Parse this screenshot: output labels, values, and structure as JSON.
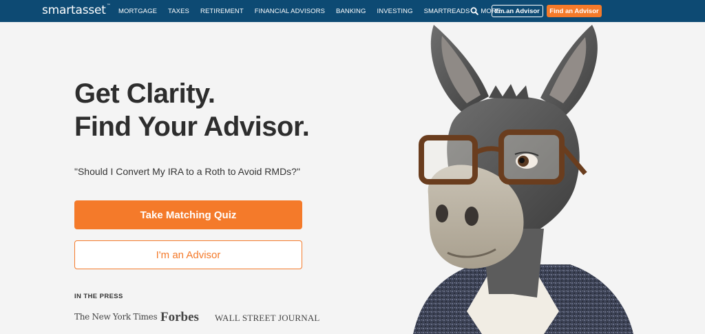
{
  "nav": {
    "logo": "smartasset",
    "logo_tm": "™",
    "links": [
      "MORTGAGE",
      "TAXES",
      "RETIREMENT",
      "FINANCIAL ADVISORS",
      "BANKING",
      "INVESTING",
      "SMARTREADS",
      "MORE"
    ],
    "advisor_button": "I'm an Advisor",
    "find_button": "Find an Advisor"
  },
  "hero": {
    "title_line1": "Get Clarity.",
    "title_line2": "Find Your Advisor.",
    "question": "\"Should I Convert My IRA to a Roth to Avoid RMDs?\"",
    "quiz_button": "Take Matching Quiz",
    "advisor_button": "I'm an Advisor"
  },
  "press": {
    "label": "IN THE PRESS",
    "nyt": "The New York Times",
    "forbes": "Forbes",
    "wsj": "WALL STREET JOURNAL"
  },
  "colors": {
    "nav_bg": "#0d4a73",
    "accent": "#f47a2a",
    "page_bg": "#f4f4f4"
  }
}
